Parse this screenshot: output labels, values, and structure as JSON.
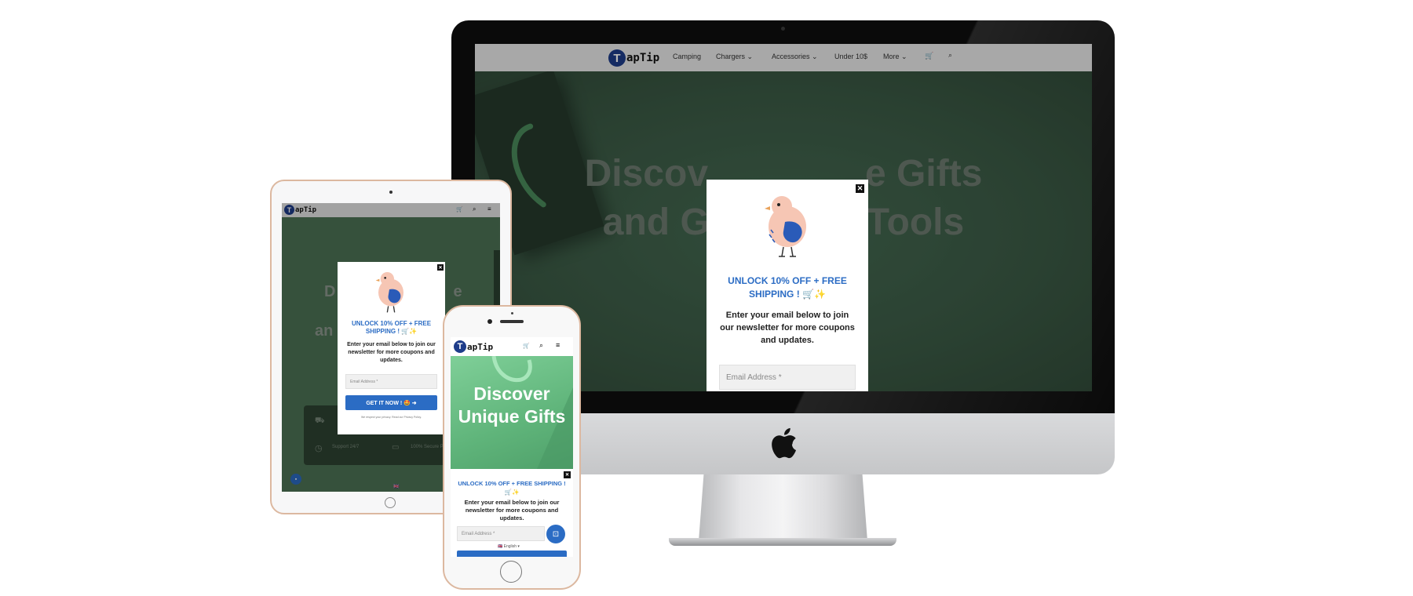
{
  "brand": {
    "name": "apTip",
    "initial": "T"
  },
  "nav": {
    "items": [
      "Camping",
      "Chargers",
      "Accessories",
      "Under 10$",
      "More"
    ]
  },
  "hero": {
    "title_line1": "Discover Unique Gifts",
    "title_line2": "and Gadget Tools",
    "desktop_line1_left": "Discov",
    "desktop_line1_right": "e Gifts",
    "desktop_line2_left": "and G",
    "desktop_line2_right": "Tools",
    "ipad_line1_left": "D",
    "ipad_line1_right": "e",
    "ipad_line2_left": "an",
    "mobile_title": "Discover Unique Gifts"
  },
  "popup": {
    "heading": "UNLOCK 10% OFF + FREE SHIPPING ! 🛒✨",
    "subtext": "Enter your email below to join our newsletter for more coupons and updates.",
    "email_placeholder": "Email Address *",
    "cta": "GET IT NOW ! 🤩 ➜",
    "close": "✕",
    "fineprint": "We respect your privacy. Read our Privacy Policy."
  },
  "ipad_bg": {
    "feature_1": "Support 24/7",
    "feature_2": "100% Secure Payment",
    "lang": "🇬🇧"
  },
  "iphone": {
    "lang": "🇬🇧 English ▾"
  },
  "colors": {
    "accent": "#2b6cc4",
    "hero_green": "#3f5c48",
    "logo_navy": "#1e3c8a"
  }
}
